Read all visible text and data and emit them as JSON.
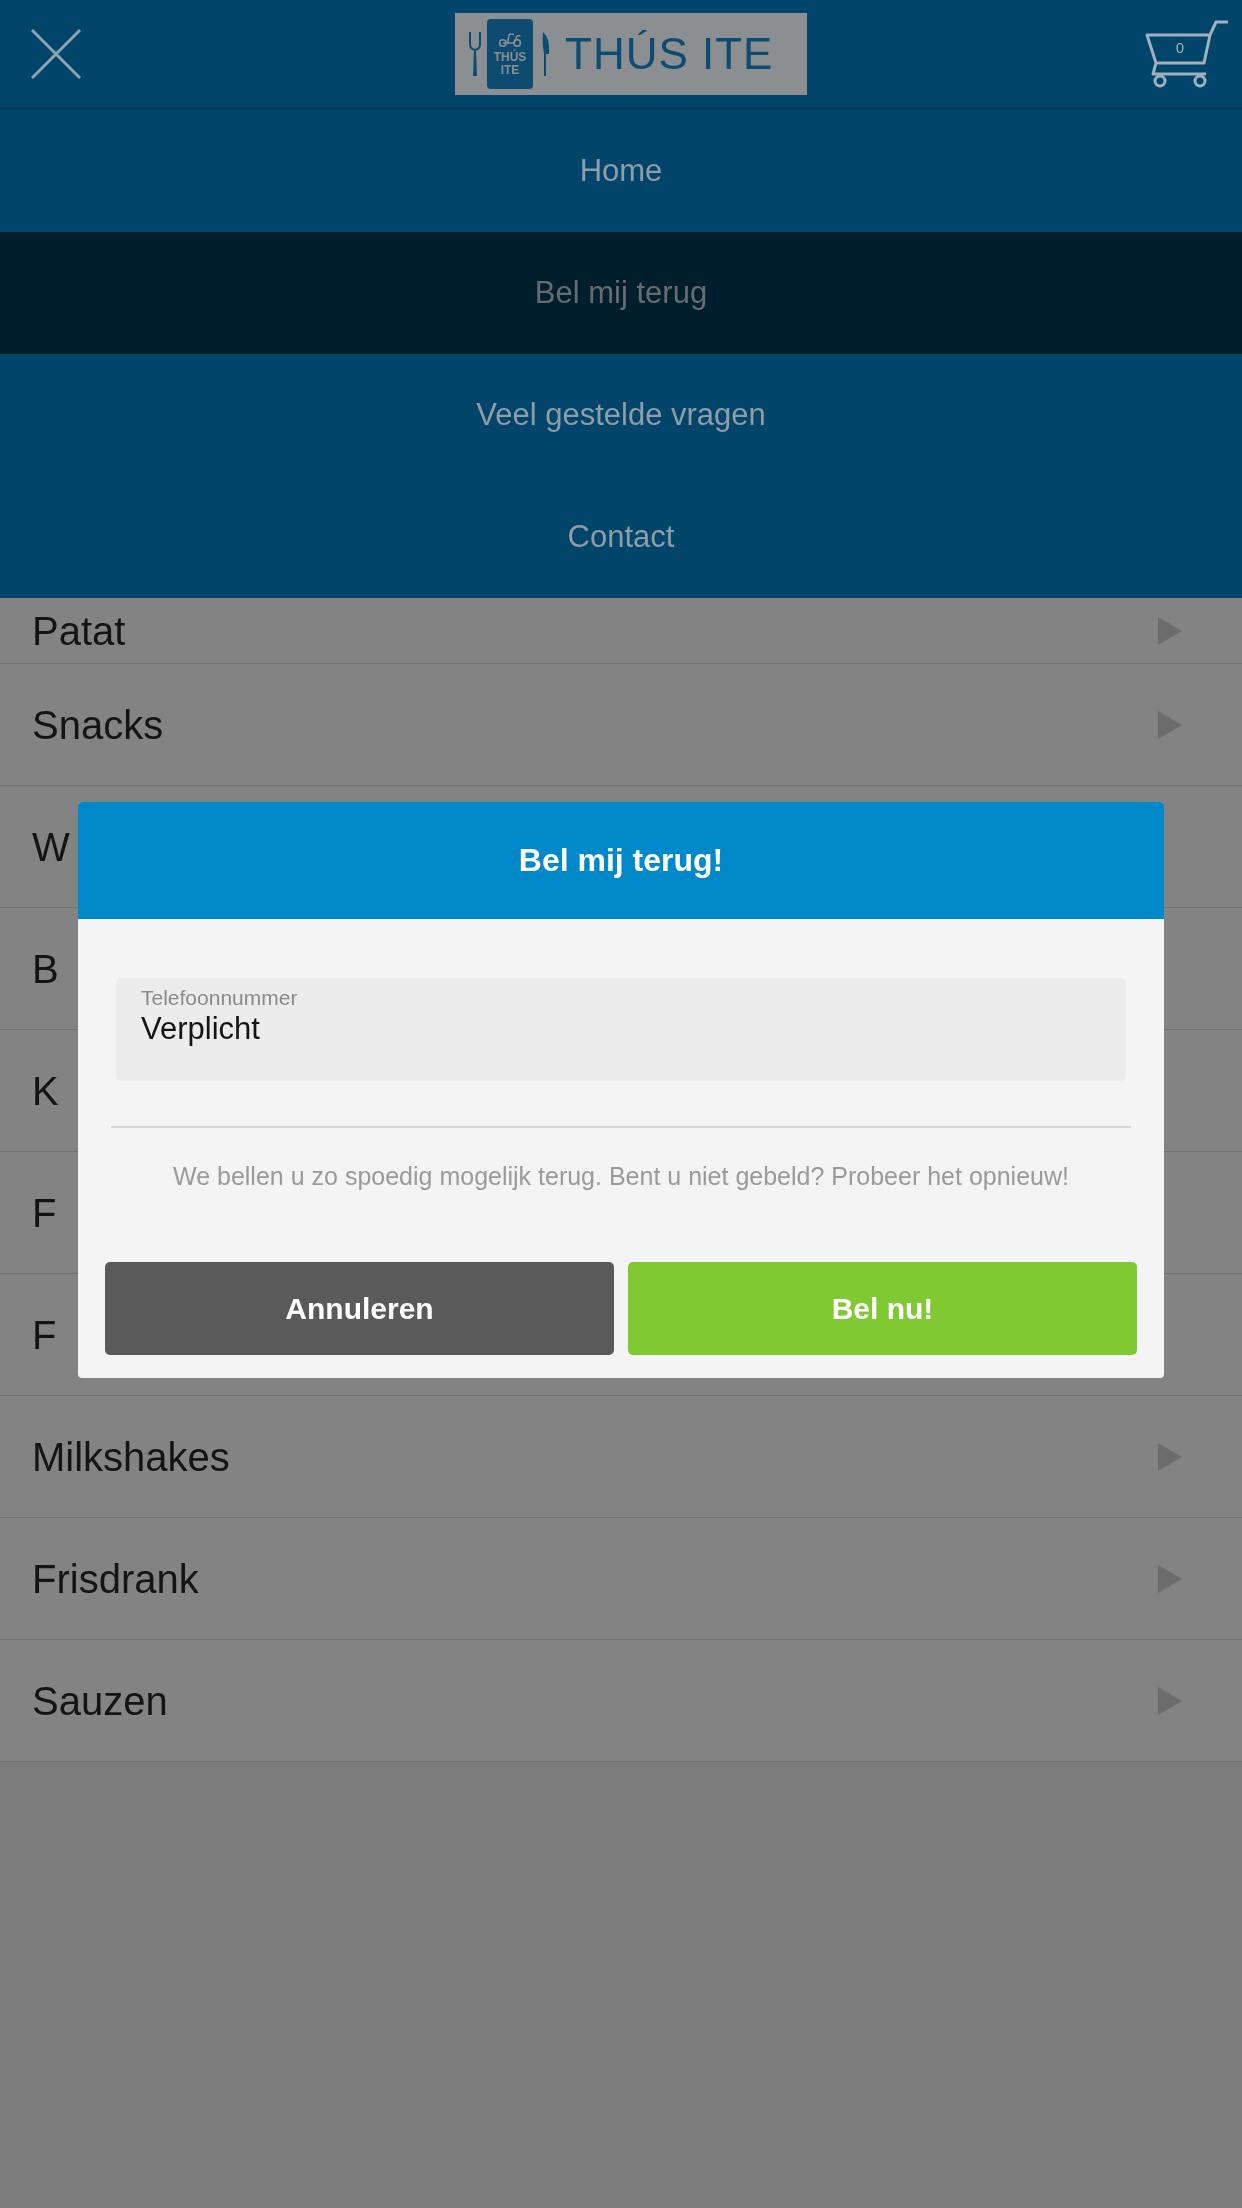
{
  "header": {
    "logo": {
      "title": "THÚS ITE",
      "badge_lines": [
        "THÚS",
        "ITE"
      ]
    },
    "cart": {
      "count": "0"
    }
  },
  "menu": {
    "items": [
      {
        "label": "Home",
        "selected": false
      },
      {
        "label": "Bel mij terug",
        "selected": true
      },
      {
        "label": "Veel gestelde vragen",
        "selected": false
      },
      {
        "label": "Contact",
        "selected": false
      }
    ]
  },
  "categories": [
    {
      "label": "Patat",
      "kind": "full"
    },
    {
      "label": "Snacks",
      "kind": "full"
    },
    {
      "label": "W",
      "kind": "cut"
    },
    {
      "label": "B",
      "kind": "cut"
    },
    {
      "label": "K",
      "kind": "cut"
    },
    {
      "label": "F",
      "kind": "cut"
    },
    {
      "label": "F",
      "kind": "cut"
    },
    {
      "label": "Milkshakes",
      "kind": "full"
    },
    {
      "label": "Frisdrank",
      "kind": "full"
    },
    {
      "label": "Sauzen",
      "kind": "full"
    }
  ],
  "dialog": {
    "title": "Bel mij terug!",
    "field": {
      "label": "Telefoonnummer",
      "placeholder": "Verplicht"
    },
    "message": "We bellen u zo spoedig mogelijk terug. Bent u niet gebeld? Probeer het opnieuw!",
    "buttons": [
      {
        "label": "Annuleren",
        "kind": "secondary"
      },
      {
        "label": "Bel nu!",
        "kind": "primary"
      }
    ]
  }
}
